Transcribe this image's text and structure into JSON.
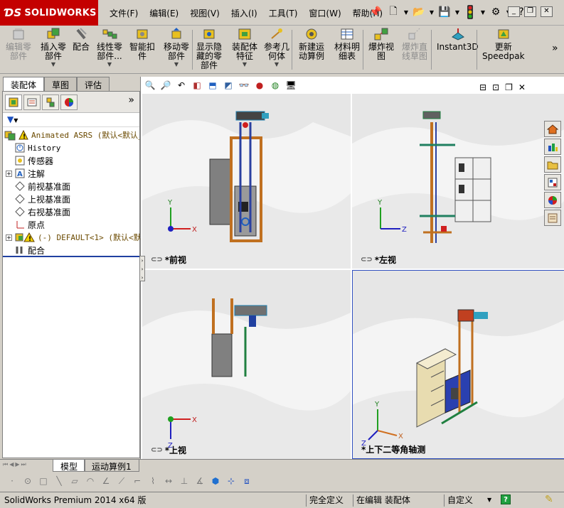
{
  "app": {
    "logo_text": "SOLIDWORKS",
    "brand_color": "#c40000"
  },
  "menu": {
    "items": [
      "文件(F)",
      "编辑(E)",
      "视图(V)",
      "插入(I)",
      "工具(T)",
      "窗口(W)",
      "帮助(H)"
    ]
  },
  "toolbar": {
    "items": [
      {
        "label1": "编辑零",
        "label2": "部件",
        "label3": "",
        "icon": "edit-component-icon",
        "disabled": true
      },
      {
        "label1": "插入零",
        "label2": "部件",
        "label3": "",
        "icon": "insert-component-icon",
        "disabled": false
      },
      {
        "label1": "配合",
        "label2": "",
        "label3": "",
        "icon": "mate-icon",
        "disabled": false
      },
      {
        "label1": "线性零",
        "label2": "部件...",
        "label3": "",
        "icon": "linear-pattern-icon",
        "disabled": false
      },
      {
        "label1": "智能扣",
        "label2": "件",
        "label3": "",
        "icon": "smart-fastener-icon",
        "disabled": false
      },
      {
        "label1": "移动零",
        "label2": "部件",
        "label3": "",
        "icon": "move-component-icon",
        "disabled": false
      },
      {
        "label1": "显示隐",
        "label2": "藏的零",
        "label3": "部件",
        "icon": "show-hidden-icon",
        "disabled": false
      },
      {
        "label1": "装配体",
        "label2": "特征",
        "label3": "",
        "icon": "assembly-feature-icon",
        "disabled": false
      },
      {
        "label1": "参考几",
        "label2": "何体",
        "label3": "",
        "icon": "reference-geometry-icon",
        "disabled": false
      },
      {
        "label1": "新建运",
        "label2": "动算例",
        "label3": "",
        "icon": "new-motion-study-icon",
        "disabled": false
      },
      {
        "label1": "材料明",
        "label2": "细表",
        "label3": "",
        "icon": "bom-icon",
        "disabled": false
      },
      {
        "label1": "爆炸视",
        "label2": "图",
        "label3": "",
        "icon": "exploded-view-icon",
        "disabled": false
      },
      {
        "label1": "爆炸直",
        "label2": "线草图",
        "label3": "",
        "icon": "explode-line-icon",
        "disabled": true
      },
      {
        "label1": "Instant3D",
        "label2": "",
        "label3": "",
        "icon": "instant3d-icon",
        "disabled": false
      },
      {
        "label1": "更新",
        "label2": "Speedpak",
        "label3": "",
        "icon": "speedpak-icon",
        "disabled": false
      }
    ],
    "more": "»"
  },
  "left_tabs": [
    "装配体",
    "草图",
    "评估"
  ],
  "feature_tree": {
    "root": "Animated ASRS  (默认<默认_",
    "items": [
      {
        "label": "History",
        "icon": "history-icon",
        "mono": true,
        "expander": false
      },
      {
        "label": "传感器",
        "icon": "sensor-icon",
        "mono": false,
        "expander": false
      },
      {
        "label": "注解",
        "icon": "annotation-icon",
        "mono": false,
        "expander": true
      },
      {
        "label": "前视基准面",
        "icon": "plane-icon",
        "mono": false,
        "expander": false
      },
      {
        "label": "上视基准面",
        "icon": "plane-icon",
        "mono": false,
        "expander": false
      },
      {
        "label": "右视基准面",
        "icon": "plane-icon",
        "mono": false,
        "expander": false
      },
      {
        "label": "原点",
        "icon": "origin-icon",
        "mono": false,
        "expander": false
      },
      {
        "label": "(-) DEFAULT<1> (默认<默",
        "icon": "part-warning-icon",
        "mono": true,
        "expander": true
      },
      {
        "label": "配合",
        "icon": "mates-icon",
        "mono": false,
        "expander": false
      }
    ]
  },
  "viewports": [
    {
      "label": "*前视"
    },
    {
      "label": "*左视"
    },
    {
      "label": "*上视"
    },
    {
      "label": "*上下二等角轴测"
    }
  ],
  "bottom_tabs": [
    "模型",
    "运动算例1"
  ],
  "status": {
    "product": "SolidWorks Premium 2014 x64 版",
    "state": "完全定义",
    "mode": "在编辑 装配体",
    "custom": "自定义"
  }
}
